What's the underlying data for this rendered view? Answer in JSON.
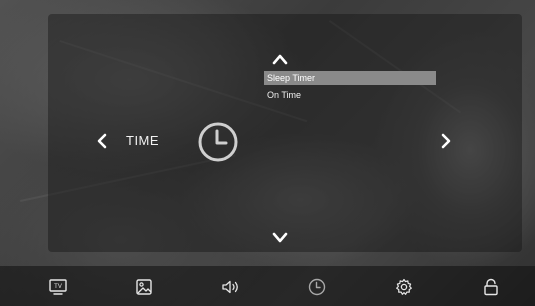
{
  "menu": {
    "title": "TIME",
    "items": [
      {
        "label": "Sleep Timer",
        "selected": true
      },
      {
        "label": "On Time",
        "selected": false
      }
    ]
  },
  "bottom_tabs": [
    {
      "id": "tv",
      "icon": "tv-icon",
      "label": "TV"
    },
    {
      "id": "picture",
      "icon": "picture-icon"
    },
    {
      "id": "sound",
      "icon": "speaker-icon"
    },
    {
      "id": "time",
      "icon": "clock-icon",
      "active": true
    },
    {
      "id": "setup",
      "icon": "gear-icon"
    },
    {
      "id": "lock",
      "icon": "lock-icon"
    }
  ],
  "colors": {
    "highlight": "#8a8a8a",
    "text": "#ffffff",
    "panel": "#141414"
  }
}
